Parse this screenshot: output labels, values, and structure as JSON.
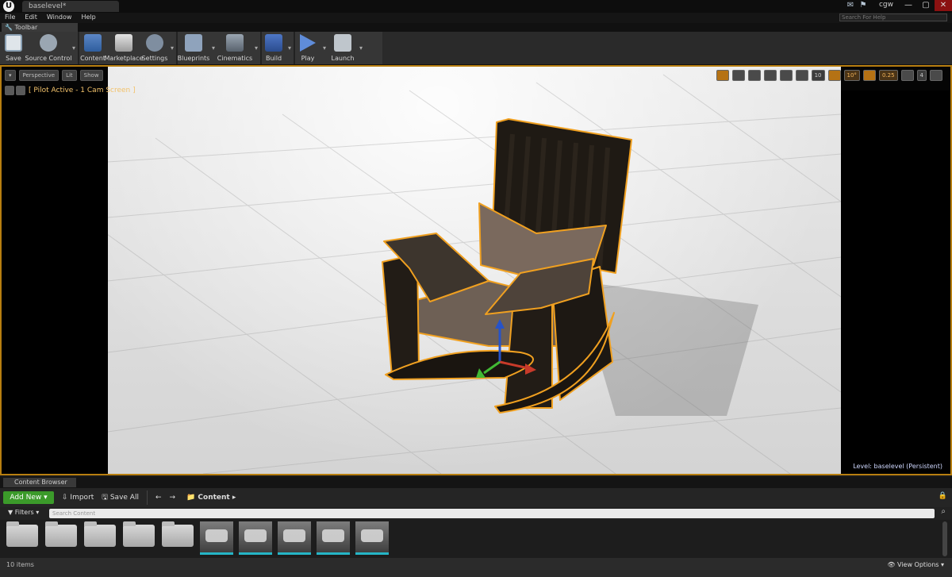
{
  "titlebar": {
    "doc_tab": "baselevel*",
    "user": "cgw",
    "controls": {
      "minimize": "—",
      "maximize": "▢",
      "close": "✕"
    }
  },
  "menu": {
    "items": [
      "File",
      "Edit",
      "Window",
      "Help"
    ],
    "search_placeholder": "Search For Help"
  },
  "toolbar_tab": "Toolbar",
  "toolbar": {
    "items": [
      {
        "label": "Save",
        "icon": "save-icon"
      },
      {
        "label": "Source Control",
        "icon": "source-control-icon"
      },
      {
        "label": "Content",
        "icon": "content-icon"
      },
      {
        "label": "Marketplace",
        "icon": "marketplace-icon"
      },
      {
        "label": "Settings",
        "icon": "settings-icon"
      },
      {
        "label": "Blueprints",
        "icon": "blueprints-icon"
      },
      {
        "label": "Cinematics",
        "icon": "cinematics-icon"
      },
      {
        "label": "Build",
        "icon": "build-icon"
      },
      {
        "label": "Play",
        "icon": "play-icon"
      },
      {
        "label": "Launch",
        "icon": "launch-icon"
      }
    ]
  },
  "viewport": {
    "buttons": {
      "perspective": "Perspective",
      "lit": "Lit",
      "show": "Show"
    },
    "pilot_text": "[ Pilot Active - 1 Cam Screen ]",
    "grid_snap": "10",
    "rot_snap": "10°",
    "scale_snap": "0.25",
    "camera_speed": "4",
    "level_label": "Level:",
    "level_name": "baselevel (Persistent)",
    "colors": {
      "border": "#b77e10",
      "selection": "#f0a020"
    }
  },
  "content_browser": {
    "tab": "Content Browser",
    "add_new": "Add New",
    "import": "Import",
    "save_all": "Save All",
    "crumb": "Content",
    "filters": "Filters",
    "search_placeholder": "Search Content",
    "items_count": "10 items",
    "view_options": "View Options"
  }
}
